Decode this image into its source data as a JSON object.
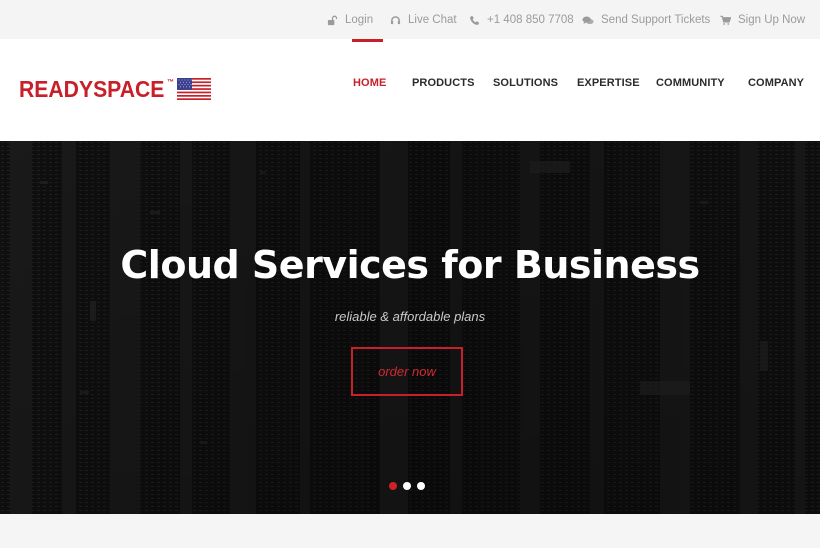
{
  "topbar": {
    "items": [
      {
        "label": "Login",
        "icon": "lock-open-icon"
      },
      {
        "label": "Live Chat",
        "icon": "headset-icon"
      },
      {
        "label": "+1 408 850 7708",
        "icon": "phone-icon"
      },
      {
        "label": "Send Support Tickets",
        "icon": "chat-bubbles-icon"
      },
      {
        "label": "Sign Up Now",
        "icon": "cart-icon"
      }
    ]
  },
  "header": {
    "logo_text": "READYSPACE",
    "logo_tm": "™",
    "flag": "us-flag-icon"
  },
  "nav": {
    "items": [
      {
        "label": "HOME",
        "active": true
      },
      {
        "label": "PRODUCTS",
        "active": false
      },
      {
        "label": "SOLUTIONS",
        "active": false
      },
      {
        "label": "EXPERTISE",
        "active": false
      },
      {
        "label": "COMMUNITY",
        "active": false
      },
      {
        "label": "COMPANY",
        "active": false
      }
    ]
  },
  "hero": {
    "title": "Cloud Services for Business",
    "subtitle": "reliable & affordable plans",
    "cta_label": "order now",
    "slides_total": 3,
    "active_slide": 1
  },
  "colors": {
    "brand_red": "#c8202a",
    "topbar_bg": "#f4f4f4",
    "topbar_text": "#9b9b9b",
    "nav_text": "#2b2b2b",
    "hero_bg": "#121212"
  }
}
